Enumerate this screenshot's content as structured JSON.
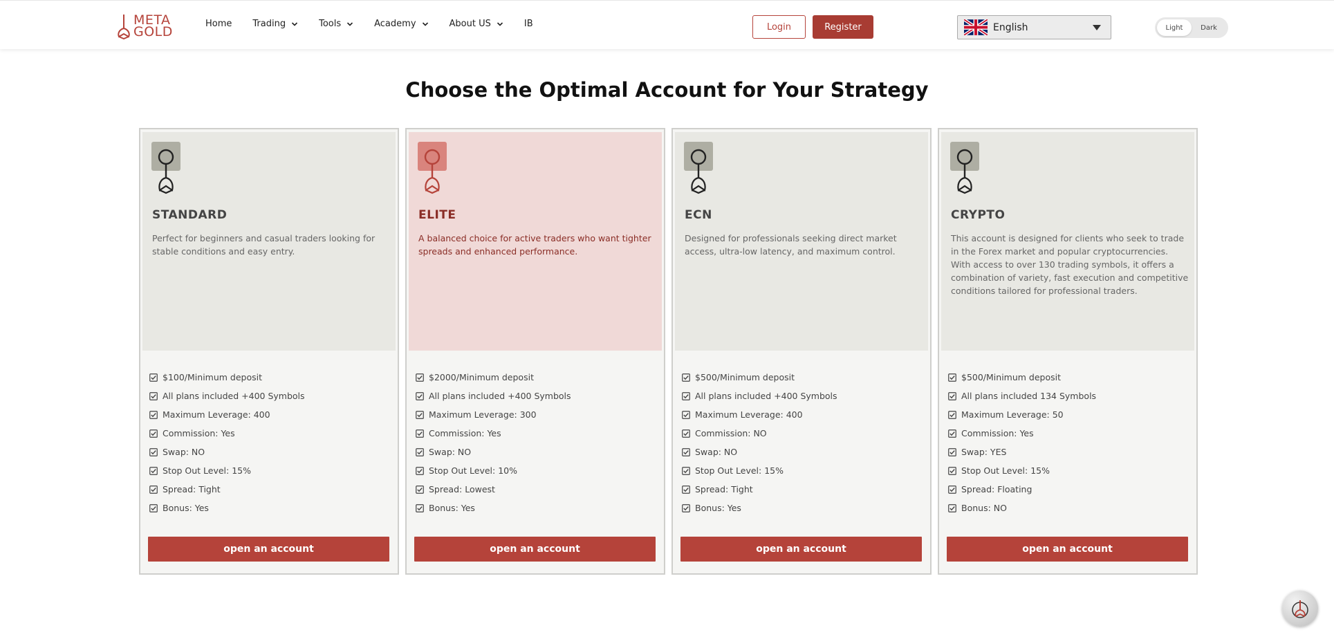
{
  "header": {
    "logo": {
      "line1": "META",
      "line2": "GOLD"
    },
    "nav": [
      {
        "label": "Home",
        "has_dropdown": false
      },
      {
        "label": "Trading",
        "has_dropdown": true
      },
      {
        "label": "Tools",
        "has_dropdown": true
      },
      {
        "label": "Academy",
        "has_dropdown": true
      },
      {
        "label": "About US",
        "has_dropdown": true
      },
      {
        "label": "IB",
        "has_dropdown": false
      }
    ],
    "login_label": "Login",
    "register_label": "Register",
    "language": "English",
    "theme": {
      "light": "Light",
      "dark": "Dark",
      "selected": "Light"
    }
  },
  "page_title": "Choose the Optimal Account for Your Strategy",
  "cards": [
    {
      "title": "STANDARD",
      "description": "Perfect for beginners and casual traders looking for stable conditions and easy entry.",
      "features": [
        "$100/Minimum deposit",
        "All plans included +400 Symbols",
        "Maximum Leverage: 400",
        "Commission: Yes",
        "Swap: NO",
        "Stop Out Level: 15%",
        "Spread: Tight",
        "Bonus: Yes"
      ],
      "button": "open an account",
      "featured": false
    },
    {
      "title": "ELITE",
      "description": "A balanced choice for active traders who want tighter spreads and enhanced performance.",
      "features": [
        "$2000/Minimum deposit",
        "All plans included +400 Symbols",
        "Maximum Leverage: 300",
        "Commission: Yes",
        "Swap: NO",
        "Stop Out Level: 10%",
        "Spread: Lowest",
        "Bonus: Yes"
      ],
      "button": "open an account",
      "featured": true
    },
    {
      "title": "ECN",
      "description": "Designed for professionals seeking direct market access, ultra-low latency, and maximum control.",
      "features": [
        "$500/Minimum deposit",
        "All plans included +400 Symbols",
        "Maximum Leverage: 400",
        "Commission: NO",
        "Swap: NO",
        "Stop Out Level: 15%",
        "Spread: Tight",
        "Bonus: Yes"
      ],
      "button": "open an account",
      "featured": false
    },
    {
      "title": "CRYPTO",
      "description": "This account is designed for clients who seek to trade in the Forex market and popular cryptocurrencies. With access to over 130 trading symbols, it offers a combination of variety, fast execution and competitive conditions tailored for professional traders.",
      "features": [
        "$500/Minimum deposit",
        "All plans included 134 Symbols",
        "Maximum Leverage: 50",
        "Commission: Yes",
        "Swap: YES",
        "Stop Out Level: 15%",
        "Spread: Floating",
        "Bonus: NO"
      ],
      "button": "open an account",
      "featured": false
    }
  ],
  "colors": {
    "accent": "#b5433a",
    "featured_bg": "#f0d9d7",
    "card_top_bg": "#e8e8e3"
  }
}
